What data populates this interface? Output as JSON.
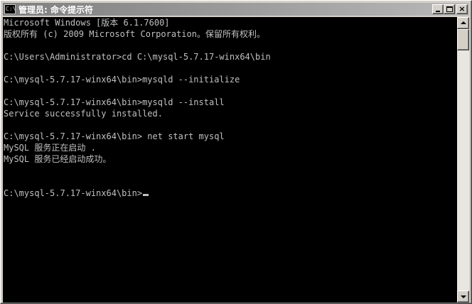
{
  "window": {
    "title": "管理员: 命令提示符",
    "icon_text": "C:\\",
    "buttons": {
      "minimize": "minimize-icon",
      "maximize": "maximize-icon",
      "close": "×"
    }
  },
  "console": {
    "lines": [
      "Microsoft Windows [版本 6.1.7600]",
      "版权所有 (c) 2009 Microsoft Corporation。保留所有权利。",
      "",
      "C:\\Users\\Administrator>cd C:\\mysql-5.7.17-winx64\\bin",
      "",
      "C:\\mysql-5.7.17-winx64\\bin>mysqld --initialize",
      "",
      "C:\\mysql-5.7.17-winx64\\bin>mysqld --install",
      "Service successfully installed.",
      "",
      "C:\\mysql-5.7.17-winx64\\bin> net start mysql",
      "MySQL 服务正在启动 .",
      "MySQL 服务已经启动成功。",
      "",
      "",
      "C:\\mysql-5.7.17-winx64\\bin>"
    ],
    "colors": {
      "background": "#000000",
      "foreground": "#c0c0c0"
    }
  }
}
